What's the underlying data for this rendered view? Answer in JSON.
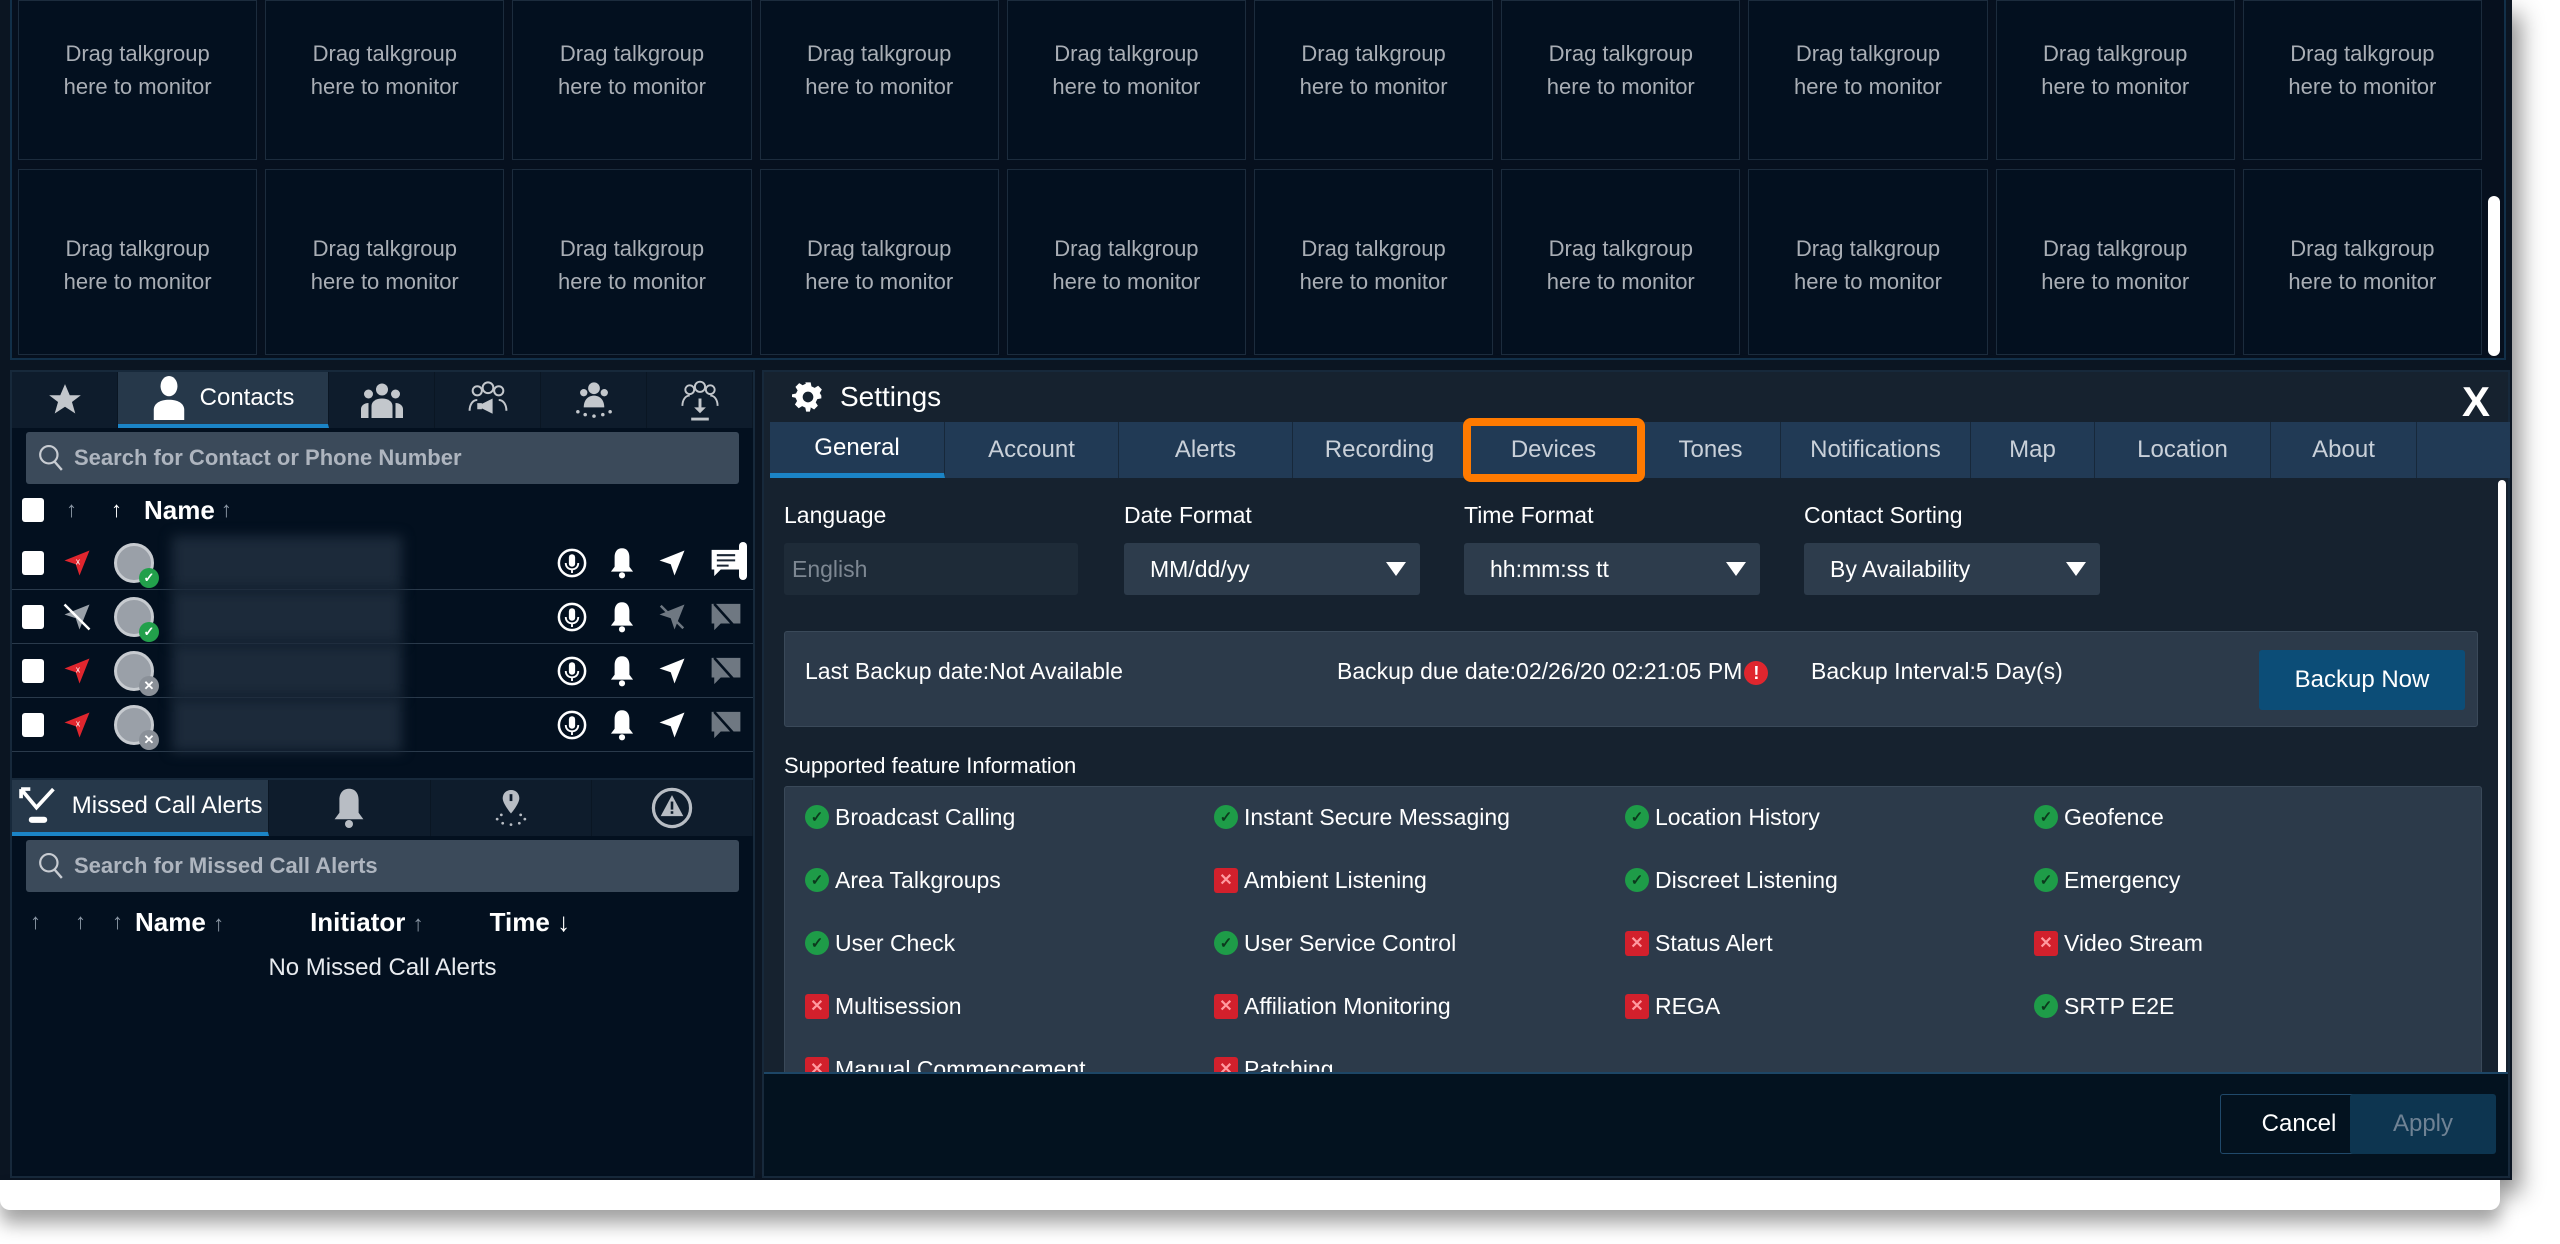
{
  "monitor": {
    "cell_text_line1": "Drag talkgroup",
    "cell_text_line2": "here to monitor",
    "cell_count": 20
  },
  "contacts_panel": {
    "tabs": [
      {
        "icon": "star-icon",
        "label": ""
      },
      {
        "icon": "person-icon",
        "label": "Contacts",
        "active": true
      },
      {
        "icon": "group-icon",
        "label": ""
      },
      {
        "icon": "broadcast-group-icon",
        "label": ""
      },
      {
        "icon": "dynamic-group-icon",
        "label": ""
      },
      {
        "icon": "download-group-icon",
        "label": ""
      }
    ],
    "search_placeholder": "Search for Contact or Phone Number",
    "column_name": "Name",
    "rows": [
      {
        "location": "location-error",
        "presence": "available",
        "message": "enabled"
      },
      {
        "location": "location-disabled",
        "presence": "available",
        "message": "disabled"
      },
      {
        "location": "location-error",
        "presence": "offline",
        "message": "disabled"
      },
      {
        "location": "location-error",
        "presence": "offline",
        "message": "disabled"
      }
    ]
  },
  "missed_panel": {
    "tab_label": "Missed Call Alerts",
    "tabs_icons": [
      "missed-call-icon",
      "bell-icon",
      "geofence-icon",
      "emergency-icon"
    ],
    "search_placeholder": "Search for Missed Call Alerts",
    "columns": {
      "name": "Name",
      "initiator": "Initiator",
      "time": "Time"
    },
    "empty_text": "No Missed Call Alerts"
  },
  "settings": {
    "title": "Settings",
    "close_label": "X",
    "tabs": [
      "General",
      "Account",
      "Alerts",
      "Recording",
      "Devices",
      "Tones",
      "Notifications",
      "Map",
      "Location",
      "About"
    ],
    "active_tab": "General",
    "highlighted_tab": "Devices",
    "highlight_color": "#ff7a00",
    "fields": {
      "language": {
        "label": "Language",
        "value": "English"
      },
      "date_format": {
        "label": "Date Format",
        "value": "MM/dd/yy"
      },
      "time_format": {
        "label": "Time Format",
        "value": "hh:mm:ss tt"
      },
      "contact_sorting": {
        "label": "Contact Sorting",
        "value": "By Availability"
      }
    },
    "backup": {
      "last": "Last Backup date:Not Available",
      "due": "Backup due date:02/26/20 02:21:05 PM",
      "interval": "Backup Interval:5 Day(s)",
      "button": "Backup Now"
    },
    "features_title": "Supported feature Information",
    "features": [
      {
        "name": "Broadcast Calling",
        "supported": true
      },
      {
        "name": "Instant Secure Messaging",
        "supported": true
      },
      {
        "name": "Location History",
        "supported": true
      },
      {
        "name": "Geofence",
        "supported": true
      },
      {
        "name": "Area Talkgroups",
        "supported": true
      },
      {
        "name": "Ambient Listening",
        "supported": false
      },
      {
        "name": "Discreet Listening",
        "supported": true
      },
      {
        "name": "Emergency",
        "supported": true
      },
      {
        "name": "User Check",
        "supported": true
      },
      {
        "name": "User Service Control",
        "supported": true
      },
      {
        "name": "Status Alert",
        "supported": false
      },
      {
        "name": "Video Stream",
        "supported": false
      },
      {
        "name": "Multisession",
        "supported": false
      },
      {
        "name": "Affiliation Monitoring",
        "supported": false
      },
      {
        "name": "REGA",
        "supported": false
      },
      {
        "name": "SRTP E2E",
        "supported": true
      },
      {
        "name": "Manual Commencement",
        "supported": false
      },
      {
        "name": "Patching",
        "supported": false
      }
    ],
    "footer": {
      "cancel": "Cancel",
      "apply": "Apply"
    }
  }
}
